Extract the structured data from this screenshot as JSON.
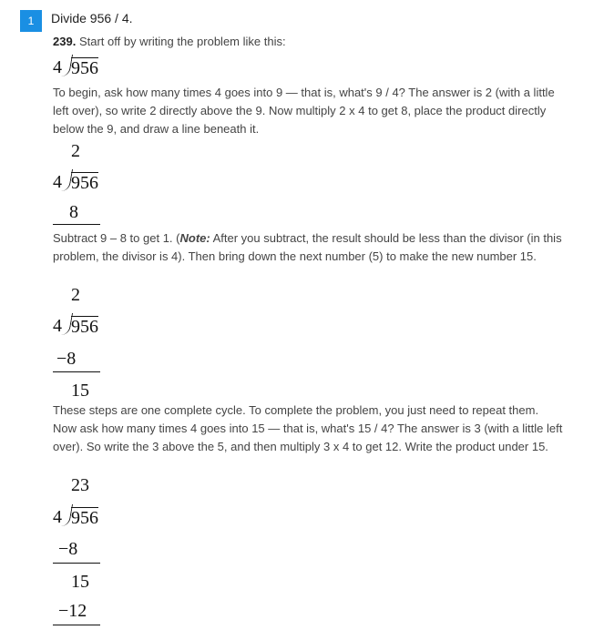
{
  "question": {
    "number": "1",
    "title": "Divide 956 / 4."
  },
  "solution": {
    "number": "239.",
    "intro": "Start off by writing the problem like this:",
    "divisor": "4",
    "dividend": "956",
    "para1": "To begin, ask how many times 4 goes into 9 — that is, what's 9 / 4? The answer is 2 (with a little left over), so write 2 directly above the 9. Now multiply 2 x 4 to get 8, place the product directly below the 9, and draw a line beneath it.",
    "step1": {
      "quotient": "2",
      "product": "8"
    },
    "para2_start": "Subtract 9 – 8 to get 1. (",
    "para2_note": "Note:",
    "para2_end": " After you subtract, the result should be less than the divisor (in this problem, the divisor is 4). Then bring down the next number (5) to make the new number 15.",
    "step2": {
      "quotient": "2",
      "product": "−8",
      "result": "15"
    },
    "para3": "These steps are one complete cycle. To complete the problem, you just need to repeat them. Now ask how many times 4 goes into 15 — that is, what's 15 / 4? The answer is 3 (with a little left over). So write the 3 above the 5, and then multiply 3 x 4 to get 12. Write the product under 15.",
    "step3": {
      "quotient": "23",
      "product1": "−8",
      "result1": "15",
      "product2": "−12"
    }
  }
}
